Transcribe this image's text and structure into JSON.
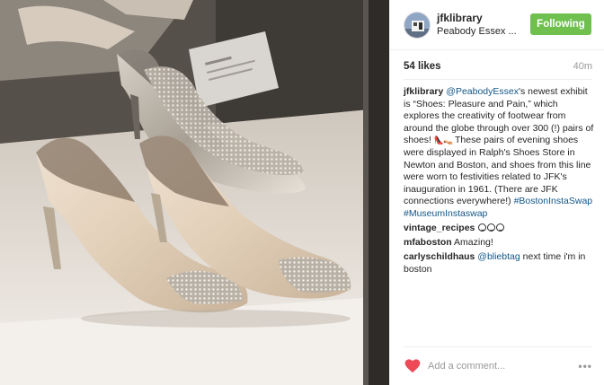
{
  "post": {
    "username": "jfklibrary",
    "location": "Peabody Essex ...",
    "follow_label": "Following",
    "likes": "54 likes",
    "time": "40m",
    "caption": {
      "user": "jfklibrary",
      "mention": "@PeabodyEssex",
      "text_1": "'s newest exhibit is “Shoes: Pleasure and Pain,” which explores the creativity of footwear from around the globe through over 300 (!) pairs of shoes!",
      "emoji": "👠👡",
      "text_2": " These pairs of evening shoes were displayed in Ralph's Shoes Store in Newton and Boston, and shoes from this line were worn to festivities related to JFK's inauguration in 1961. (There are JFK connections everywhere!)",
      "tag_1": "#BostonInstaSwap",
      "tag_2": "#MuseumInstaswap"
    },
    "comments": [
      {
        "user": "vintage_recipes",
        "text": ""
      },
      {
        "user": "mfaboston",
        "text": "Amazing!"
      },
      {
        "user": "carlyschildhaus",
        "mention": "@bliebtag",
        "text": "next time i'm in boston"
      }
    ],
    "add_comment_placeholder": "Add a comment...",
    "more_label": "•••",
    "colors": {
      "follow": "#70c050",
      "link": "#125688",
      "heart": "#ed4956"
    }
  },
  "photo": {
    "description_icon": "photo-evening-shoes",
    "label_card": "display label"
  }
}
